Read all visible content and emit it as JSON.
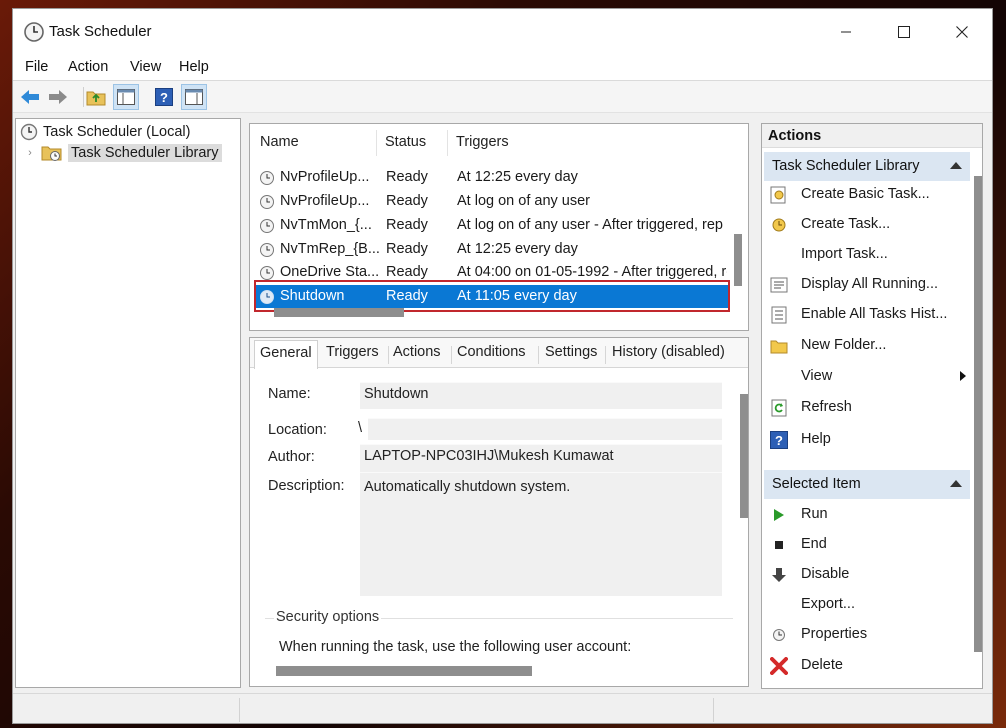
{
  "window": {
    "title": "Task Scheduler"
  },
  "menu": [
    "File",
    "Action",
    "View",
    "Help"
  ],
  "tree": {
    "root": "Task Scheduler (Local)",
    "library": "Task Scheduler Library"
  },
  "task_list": {
    "columns": [
      "Name",
      "Status",
      "Triggers"
    ],
    "rows": [
      {
        "name": "NvProfileUp...",
        "status": "Ready",
        "trigger": "At 12:25 every day"
      },
      {
        "name": "NvProfileUp...",
        "status": "Ready",
        "trigger": "At log on of any user"
      },
      {
        "name": "NvTmMon_{...",
        "status": "Ready",
        "trigger": "At log on of any user - After triggered, rep"
      },
      {
        "name": "NvTmRep_{B...",
        "status": "Ready",
        "trigger": "At 12:25 every day"
      },
      {
        "name": "OneDrive Sta...",
        "status": "Ready",
        "trigger": "At 04:00 on 01-05-1992 - After triggered, re"
      },
      {
        "name": "Shutdown",
        "status": "Ready",
        "trigger": "At 11:05 every day"
      }
    ]
  },
  "details": {
    "tabs": [
      "General",
      "Triggers",
      "Actions",
      "Conditions",
      "Settings",
      "History (disabled)"
    ],
    "name_label": "Name:",
    "name_value": "Shutdown",
    "location_label": "Location:",
    "location_value": "\\",
    "author_label": "Author:",
    "author_value": "LAPTOP-NPC03IHJ\\Mukesh Kumawat",
    "description_label": "Description:",
    "description_value": "Automatically shutdown system.",
    "security_title": "Security options",
    "security_text": "When running the task, use the following user account:"
  },
  "actions": {
    "header": "Actions",
    "library_section": "Task Scheduler Library",
    "library_items": [
      "Create Basic Task...",
      "Create Task...",
      "Import Task...",
      "Display All Running...",
      "Enable All Tasks Hist...",
      "New Folder...",
      "View",
      "Refresh",
      "Help"
    ],
    "selected_section": "Selected Item",
    "selected_items": [
      "Run",
      "End",
      "Disable",
      "Export...",
      "Properties",
      "Delete"
    ]
  },
  "colors": {
    "selection": "#0a78d4",
    "highlight_outline": "#c1272d",
    "section_header": "#dbe6f2"
  }
}
